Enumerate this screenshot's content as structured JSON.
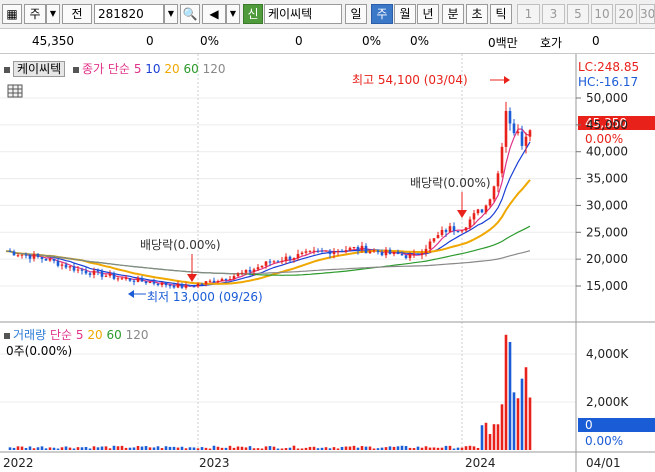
{
  "toolbar": {
    "market": "주",
    "prev_label": "전",
    "code": "281820",
    "credit_badge": "신",
    "stock_name": "케이씨텍",
    "periods": [
      "일",
      "주",
      "월",
      "년",
      "분",
      "초",
      "틱"
    ],
    "selected_period": "주",
    "counts": [
      "1",
      "3",
      "5",
      "10",
      "20",
      "30"
    ]
  },
  "infobar": {
    "price": "45,350",
    "change": "0",
    "change_rate": "0%",
    "volume": "0",
    "vol_rate": "0%",
    "extra_rate": "0%",
    "amount": "0백만",
    "quote_label": "호가",
    "quote_value": "0"
  },
  "price_panel": {
    "name": "케이씨텍",
    "ma_label": "종가 단순",
    "ma_periods": [
      "5",
      "10",
      "20",
      "60",
      "120"
    ],
    "lc_label": "LC:248.85",
    "hc_label": "HC:-16.17",
    "current_price_label": "45,350",
    "current_change_label": "0.00%",
    "axis_ticks": [
      "50,000",
      "45,000",
      "40,000",
      "35,000",
      "30,000",
      "25,000",
      "20,000",
      "15,000"
    ],
    "high_annotation": "최고 54,100 (03/04)",
    "low_annotation": "최저 13,000 (09/26)",
    "dividend_annotation_1": "배당락(0.00%)",
    "dividend_annotation_2": "배당락(0.00%)"
  },
  "volume_panel": {
    "title": "거래량",
    "ma_label": "단순",
    "ma_periods": [
      "5",
      "20",
      "60",
      "120"
    ],
    "value_label": "0주(0.00%)",
    "axis_ticks": [
      "4,000K",
      "2,000K"
    ],
    "current_value": "0",
    "current_rate": "0.00%"
  },
  "x_axis": {
    "labels": [
      "2022",
      "2023",
      "2024",
      "04/01"
    ]
  },
  "colors": {
    "up": "#e8221b",
    "down": "#1a5bd6",
    "ma5": "#e0338a",
    "ma10": "#1a3fd6",
    "ma20": "#f0a800",
    "ma60": "#2b9a2b",
    "ma120": "#888888"
  }
}
